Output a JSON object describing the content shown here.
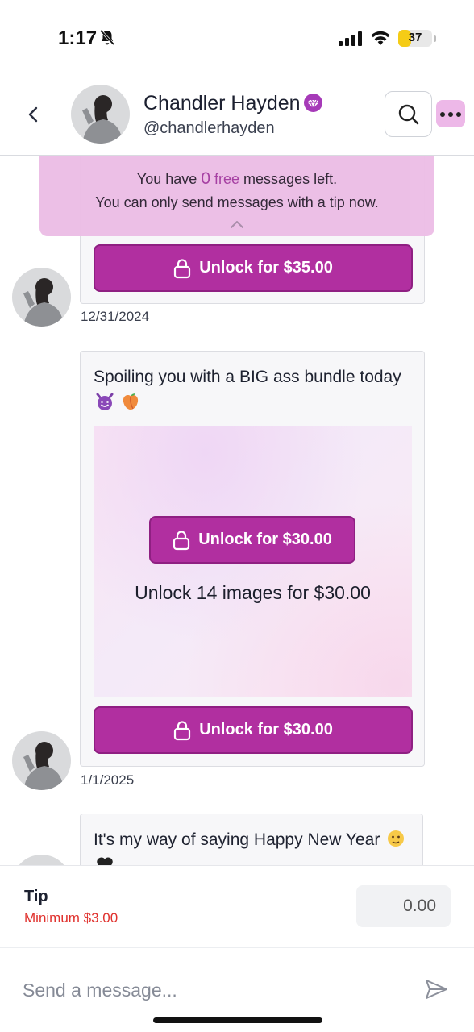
{
  "status": {
    "time": "1:17",
    "battery": "37",
    "battery_level": 0.37
  },
  "header": {
    "name": "Chandler Hayden",
    "handle": "@chandlerhayden"
  },
  "banner": {
    "line1_prefix": "You have ",
    "free_count": "0",
    "free_word": "free",
    "line1_suffix": " messages left.",
    "line2": "You can only send messages with a tip now."
  },
  "messages": [
    {
      "unlock_label": "Unlock for $35.00",
      "date": "12/31/2024"
    },
    {
      "text": "Spoiling you with a BIG ass bundle today",
      "emojis": [
        "smiling-devil-emoji",
        "peach-emoji"
      ],
      "media_unlock_label": "Unlock for $30.00",
      "media_caption": "Unlock 14 images for $30.00",
      "unlock_label": "Unlock for $30.00",
      "date": "1/1/2025"
    },
    {
      "text": "It's my way of saying Happy New Year",
      "emojis": [
        "face-emoji",
        "black-heart-emoji"
      ]
    }
  ],
  "composer": {
    "tip_label": "Tip",
    "tip_minimum": "Minimum $3.00",
    "tip_value": "0.00",
    "message_placeholder": "Send a message..."
  },
  "colors": {
    "accent": "#b12fa0",
    "banner": "#ecbde6",
    "error": "#e0312d",
    "battery": "#f5cc16"
  }
}
